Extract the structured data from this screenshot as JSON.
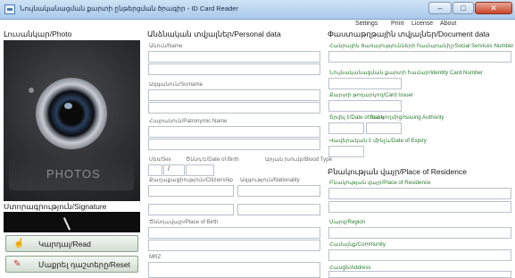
{
  "window": {
    "title": "Նույնականացման քարտի ընթերցման ծրագիր - ID Card Reader"
  },
  "titlebar_buttons": [
    "–",
    "□",
    "✕"
  ],
  "menu": [
    "Settings",
    "Print",
    "License",
    "About"
  ],
  "photo_section": {
    "title": "Լուսանկար/Photo",
    "placeholder": "PHOTOS"
  },
  "signature_section": {
    "title": "Ստորագրություն/Signature"
  },
  "buttons": {
    "read": "Կարդալ/Read",
    "reset": "Մաքրել դաշտերը/Reset"
  },
  "personal": {
    "title": "Անձնական տվյալներ/Personal data",
    "name": "Անուն/Name",
    "surname": "Ազգանուն/Surname",
    "patronymic": "Հայրանուն/Patronymic Name",
    "sex": "Սեռ/Sex",
    "dob": "Ծննդ.Ե/Date of Birth",
    "blood": "Արյան խումբ/Blood Type",
    "dob_value": "/",
    "citizenship": "Քաղաքացիություն/Citizenship",
    "nationality": "Ազգություն/Nationality",
    "pob": "Ծննդավայր/Place of Birth",
    "mrz": "MRZ"
  },
  "document": {
    "title": "Փաստաթղթային տվյալներ/Document data",
    "ssn": "Հանրային ծառայությունների համարանիշ/Social Services Number",
    "id_number": "Նույնականացման քարտի համար/Identity Card Number",
    "issuer": "Քարտի թողարկող/Card Issuer",
    "date_of_issue": "Տրվել է/Date of Issue",
    "issuing_authority": "Ում կողմից/Issuing Authority",
    "date_of_expiry": "Վավերական է մինչև/Date of Expiry"
  },
  "residence": {
    "title": "Բնակության վայր/Place of Residence",
    "place": "Բնակության վայր/Place of Residence",
    "region": "Մարզ/Region",
    "community": "Համայնք/Community",
    "address": "Հասցե/Address"
  }
}
